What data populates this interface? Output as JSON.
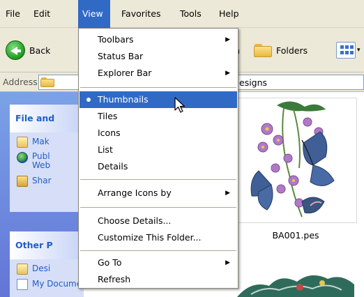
{
  "menubar": {
    "items": [
      {
        "label": "File"
      },
      {
        "label": "Edit"
      },
      {
        "label": "View"
      },
      {
        "label": "Favorites"
      },
      {
        "label": "Tools"
      },
      {
        "label": "Help"
      }
    ]
  },
  "toolbar": {
    "back_label": "Back",
    "folders_label": "Folders",
    "partial_label": "h"
  },
  "address": {
    "label": "Address",
    "value_visible": "esigns"
  },
  "taskpane": {
    "file_panel": {
      "title": "File and",
      "items": [
        {
          "label": "Mak",
          "icon": "folder-new-icon"
        },
        {
          "label": "Publ",
          "label2": "Web",
          "icon": "publish-globe-icon"
        },
        {
          "label": "Shar",
          "icon": "share-folder-icon"
        }
      ]
    },
    "other_panel": {
      "title": "Other P",
      "items": [
        {
          "label": "Desi",
          "icon": "folder-icon"
        },
        {
          "label": "My Documents",
          "icon": "my-documents-icon"
        }
      ]
    }
  },
  "content": {
    "thumbnail_caption": "BA001.pes"
  },
  "view_menu": {
    "items": {
      "toolbars": "Toolbars",
      "status_bar": "Status Bar",
      "explorer_bar": "Explorer Bar",
      "thumbnails": "Thumbnails",
      "tiles": "Tiles",
      "icons": "Icons",
      "list": "List",
      "details": "Details",
      "arrange": "Arrange Icons by",
      "choose_details": "Choose Details...",
      "customize": "Customize This Folder...",
      "go_to": "Go To",
      "refresh": "Refresh"
    },
    "selected": "Thumbnails"
  },
  "colors": {
    "highlight": "#316ac5",
    "chrome": "#ece9d8",
    "taskpane": "#6f8fdc",
    "link": "#215dc6"
  }
}
